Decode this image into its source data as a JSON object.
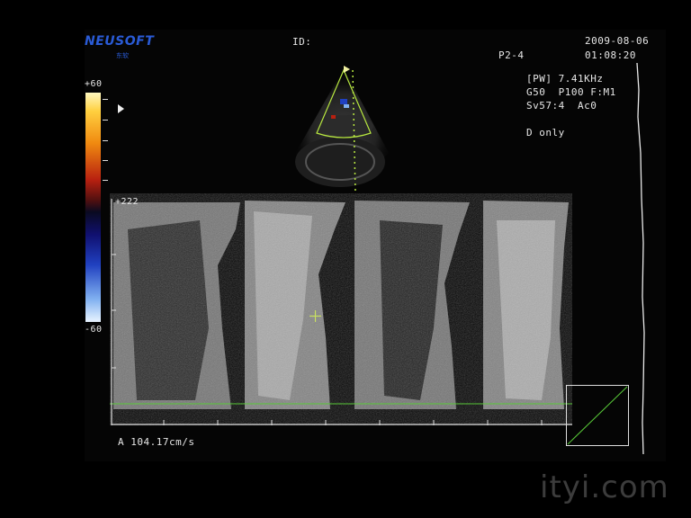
{
  "brand": {
    "name": "NEUSOFT",
    "sub": "东软"
  },
  "header": {
    "id_label": "ID:",
    "date": "2009-08-06",
    "time": "01:08:20",
    "probe": "P2-4"
  },
  "params": {
    "line1": "[PW] 7.41KHz",
    "line2": "G50  P100 F:M1",
    "line3": "Sv57:4  Ac0",
    "mode": "D only"
  },
  "color_scale": {
    "top": "+60",
    "bottom": "-60"
  },
  "doppler": {
    "scale_label": "+222",
    "measurement": "A 104.17cm/s"
  },
  "watermark": "ityi.com",
  "colors": {
    "sector_outline": "#b8e840",
    "baseline": "#58c838",
    "brand": "#2a5bd6"
  },
  "icons": [
    "sector-marker-icon",
    "crosshair-cursor-icon",
    "colorbar-pointer-icon"
  ]
}
